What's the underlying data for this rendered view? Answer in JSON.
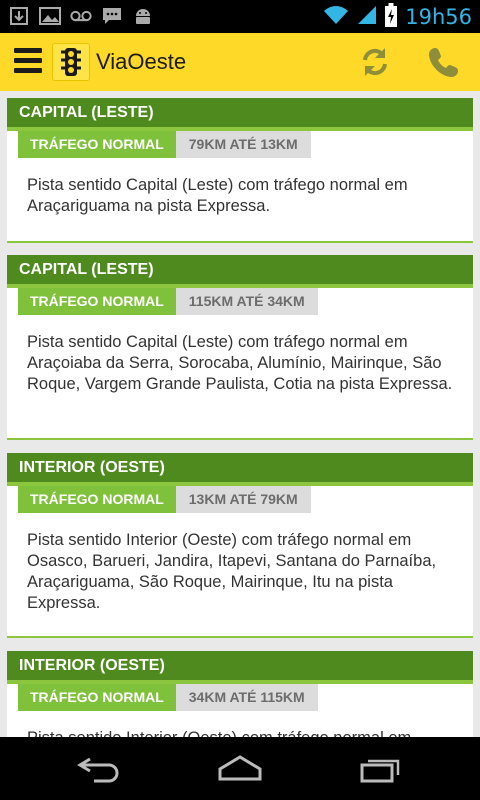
{
  "status_bar": {
    "left_icons": [
      "download-icon",
      "image-icon",
      "voicemail-icon",
      "sms-icon",
      "android-icon"
    ],
    "right_icons": [
      "wifi-icon",
      "signal-icon",
      "battery-charging-icon"
    ],
    "time": "19h56"
  },
  "action_bar": {
    "title": "ViaOeste",
    "icons": [
      "menu-icon",
      "traffic-light-icon",
      "refresh-icon",
      "phone-icon"
    ]
  },
  "cards": [
    {
      "direction": "CAPITAL (LESTE)",
      "status": "TRÁFEGO NORMAL",
      "range": "79KM ATÉ 13KM",
      "description": "Pista sentido Capital (Leste) com tráfego normal em Araçariguama  na pista Expressa."
    },
    {
      "direction": "CAPITAL (LESTE)",
      "status": "TRÁFEGO NORMAL",
      "range": "115KM ATÉ 34KM",
      "description": "Pista sentido Capital (Leste) com tráfego normal em Araçoiaba da Serra, Sorocaba, Alumínio, Mairinque, São Roque, Vargem Grande Paulista, Cotia  na pista Expressa."
    },
    {
      "direction": "INTERIOR (OESTE)",
      "status": "TRÁFEGO NORMAL",
      "range": "13KM ATÉ 79KM",
      "description": "Pista sentido Interior (Oeste) com tráfego normal em Osasco, Barueri, Jandira, Itapevi, Santana do Parnaíba, Araçariguama, São Roque, Mairinque, Itu na pista Expressa."
    },
    {
      "direction": "INTERIOR (OESTE)",
      "status": "TRÁFEGO NORMAL",
      "range": "34KM ATÉ 115KM",
      "description": "Pista sentido Interior (Oeste) com tráfego normal em"
    }
  ],
  "nav_bar": {
    "icons": [
      "back-icon",
      "home-icon",
      "recent-apps-icon"
    ]
  },
  "colors": {
    "action_bar": "#ffd928",
    "card_header": "#4e8a1e",
    "status_badge": "#7fc13b",
    "range_badge": "#dcdcdc",
    "clock": "#33b5e5"
  }
}
